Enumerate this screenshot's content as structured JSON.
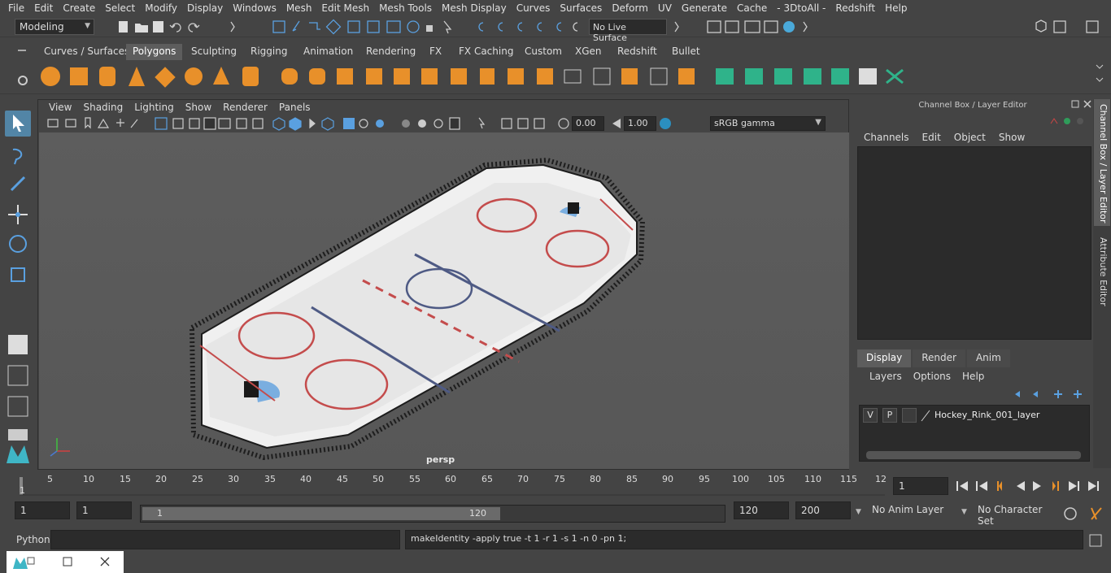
{
  "menu": [
    "File",
    "Edit",
    "Create",
    "Select",
    "Modify",
    "Display",
    "Windows",
    "Mesh",
    "Edit Mesh",
    "Mesh Tools",
    "Mesh Display",
    "Curves",
    "Surfaces",
    "Deform",
    "UV",
    "Generate",
    "Cache",
    "- 3DtoAll -",
    "Redshift",
    "Help"
  ],
  "status": {
    "mode": "Modeling",
    "live_surface": "No Live Surface"
  },
  "shelf_tabs": [
    "Curves / Surfaces",
    "Polygons",
    "Sculpting",
    "Rigging",
    "Animation",
    "Rendering",
    "FX",
    "FX Caching",
    "Custom",
    "XGen",
    "Redshift",
    "Bullet"
  ],
  "shelf_active": "Polygons",
  "panel_menu": [
    "View",
    "Shading",
    "Lighting",
    "Show",
    "Renderer",
    "Panels"
  ],
  "panel_toolbar": {
    "exposure": "0.00",
    "gamma": "1.00",
    "colorspace": "sRGB gamma"
  },
  "viewport": {
    "camera": "persp"
  },
  "channel_box": {
    "title": "Channel Box / Layer Editor",
    "menu": [
      "Channels",
      "Edit",
      "Object",
      "Show"
    ]
  },
  "layer_editor": {
    "tabs": [
      "Display",
      "Render",
      "Anim"
    ],
    "menu": [
      "Layers",
      "Options",
      "Help"
    ],
    "layer": {
      "v": "V",
      "p": "P",
      "name": "Hockey_Rink_001_layer"
    }
  },
  "side_tabs": [
    "Channel Box / Layer Editor",
    "Attribute Editor"
  ],
  "timeline": {
    "ticks": [
      "5",
      "10",
      "15",
      "20",
      "25",
      "30",
      "35",
      "40",
      "45",
      "50",
      "55",
      "60",
      "65",
      "70",
      "75",
      "80",
      "85",
      "90",
      "95",
      "100",
      "105",
      "110",
      "115",
      "12"
    ],
    "start_marker": "1",
    "current_frame": "1"
  },
  "range": {
    "start": "1",
    "playback_start": "1",
    "slider_start": "1",
    "slider_end": "120",
    "playback_end": "120",
    "end": "200",
    "anim_layer": "No Anim Layer",
    "character_set": "No Character Set"
  },
  "command": {
    "language": "Python",
    "output": "makeIdentity -apply true -t 1 -r 1 -s 1 -n 0 -pn 1;"
  }
}
